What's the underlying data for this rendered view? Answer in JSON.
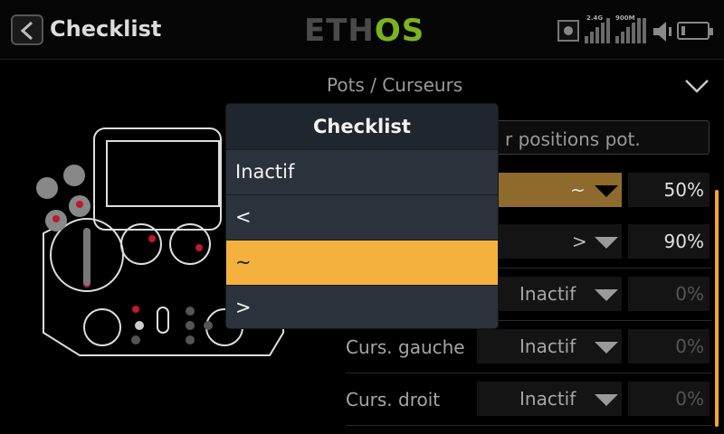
{
  "header": {
    "title": "Checklist",
    "logo_left": "ETH",
    "logo_right": "OS",
    "signal_24g_label": "2.4G",
    "signal_900m_label": "900M"
  },
  "section": {
    "title": "Pots / Curseurs"
  },
  "background": {
    "hint_text": "r positions pot.",
    "rows": [
      {
        "label": "",
        "value": "~",
        "percent": "50%"
      },
      {
        "label": "",
        "value": ">",
        "percent": "90%"
      },
      {
        "label": "",
        "value": "Inactif",
        "percent": "0%"
      },
      {
        "label": "Curs. gauche",
        "value": "Inactif",
        "percent": "0%"
      },
      {
        "label": "Curs. droit",
        "value": "Inactif",
        "percent": "0%"
      }
    ]
  },
  "modal": {
    "title": "Checklist",
    "options": [
      "Inactif",
      "<",
      "~",
      ">"
    ],
    "selected_index": 2
  },
  "colors": {
    "accent": "#f5b13d",
    "logo_green": "#7ab51d",
    "active_row": "#8e6b2c"
  }
}
